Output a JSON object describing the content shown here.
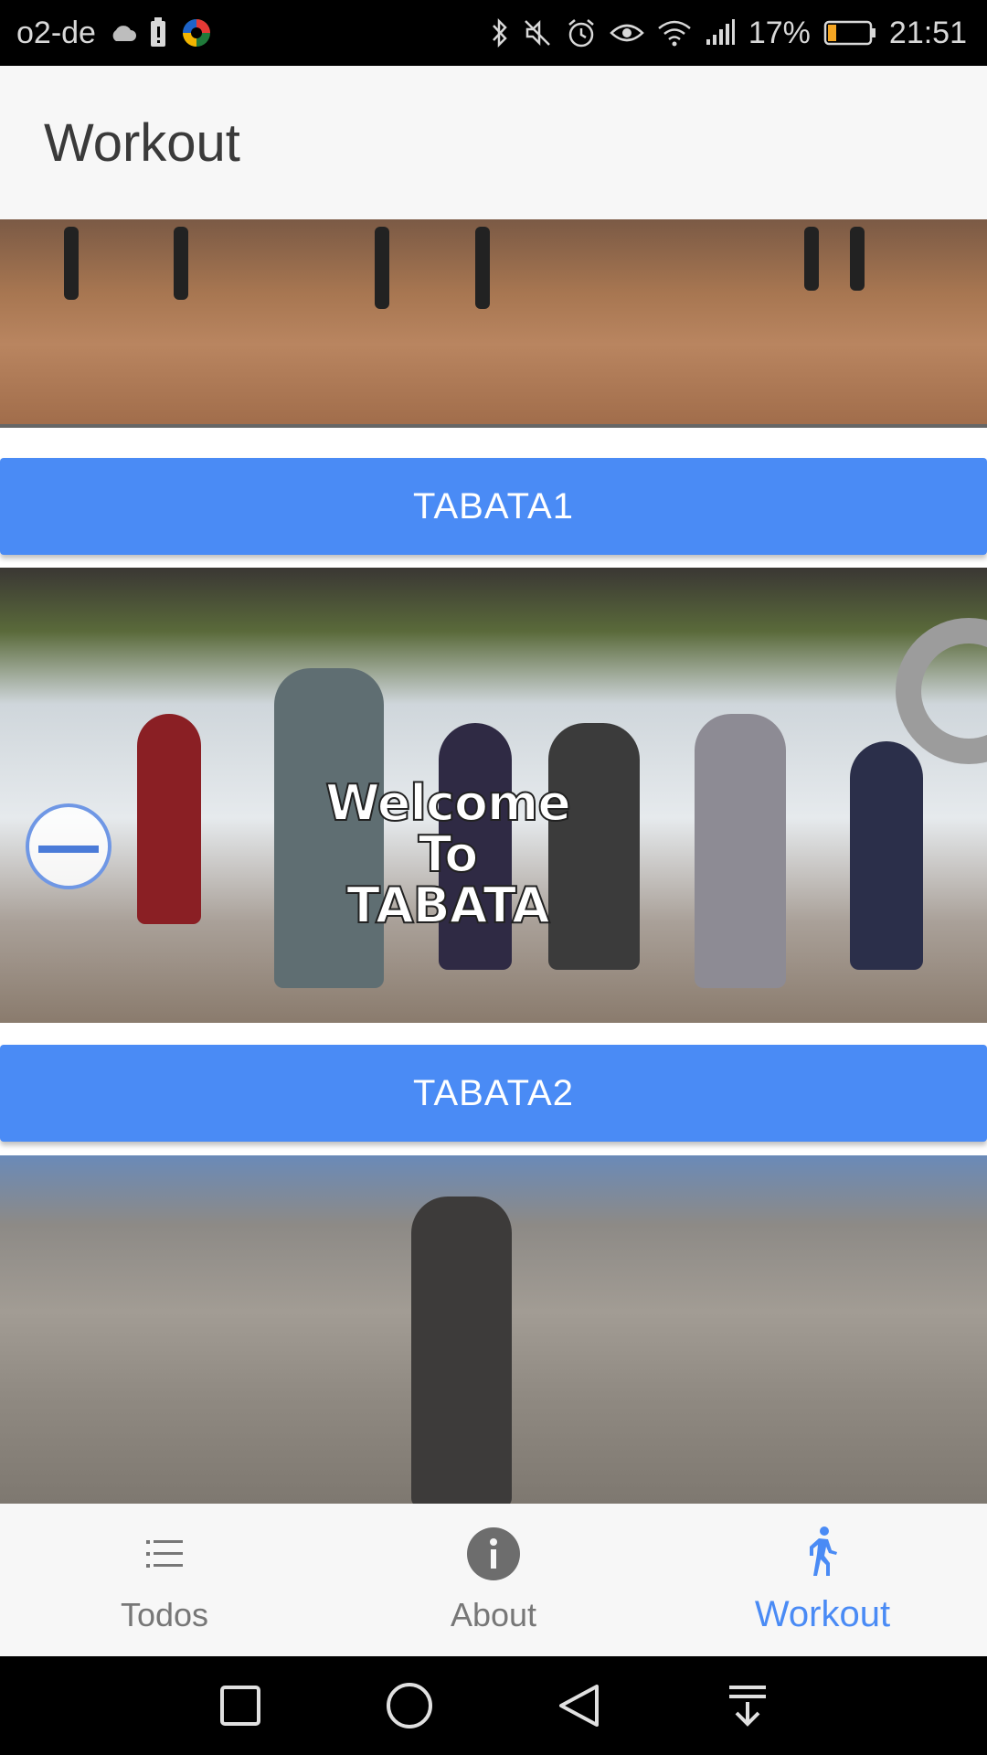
{
  "status_bar": {
    "carrier": "o2-de",
    "battery_percent": "17%",
    "time": "21:51",
    "icons": [
      "cloud-icon",
      "battery-alert-icon",
      "app-icon",
      "bluetooth-icon",
      "mute-icon",
      "alarm-icon",
      "eye-icon",
      "wifi-icon",
      "signal-icon",
      "battery-icon"
    ]
  },
  "header": {
    "title": "Workout"
  },
  "content": {
    "video_2_overlay_text": "Welcome To TABATA",
    "buttons": [
      {
        "label": "TABATA1"
      },
      {
        "label": "TABATA2"
      }
    ]
  },
  "bottom_nav": {
    "items": [
      {
        "label": "Todos",
        "icon": "list-icon",
        "active": false
      },
      {
        "label": "About",
        "icon": "info-icon",
        "active": false
      },
      {
        "label": "Workout",
        "icon": "walk-icon",
        "active": true
      }
    ]
  },
  "system_nav": {
    "icons": [
      "recents-icon",
      "home-icon",
      "back-icon",
      "notifications-down-icon"
    ]
  },
  "colors": {
    "accent": "#4a8bf5",
    "header_bg": "#f7f7f7",
    "status_bar_bg": "#000000"
  }
}
